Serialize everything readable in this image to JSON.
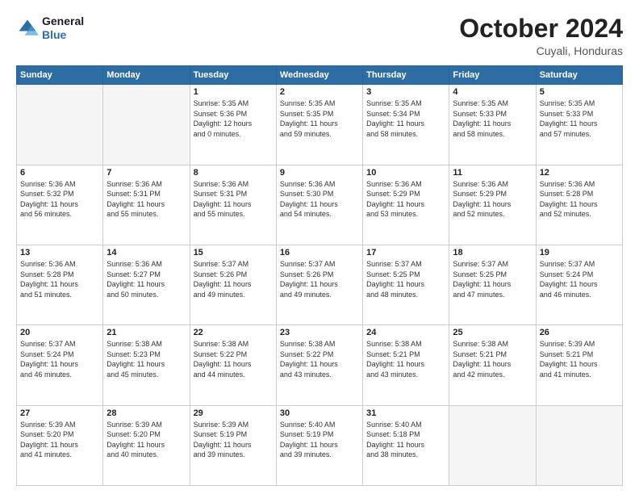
{
  "header": {
    "logo_line1": "General",
    "logo_line2": "Blue",
    "month": "October 2024",
    "location": "Cuyali, Honduras"
  },
  "weekdays": [
    "Sunday",
    "Monday",
    "Tuesday",
    "Wednesday",
    "Thursday",
    "Friday",
    "Saturday"
  ],
  "weeks": [
    [
      {
        "day": "",
        "empty": true
      },
      {
        "day": "",
        "empty": true
      },
      {
        "day": "1",
        "lines": [
          "Sunrise: 5:35 AM",
          "Sunset: 5:36 PM",
          "Daylight: 12 hours",
          "and 0 minutes."
        ]
      },
      {
        "day": "2",
        "lines": [
          "Sunrise: 5:35 AM",
          "Sunset: 5:35 PM",
          "Daylight: 11 hours",
          "and 59 minutes."
        ]
      },
      {
        "day": "3",
        "lines": [
          "Sunrise: 5:35 AM",
          "Sunset: 5:34 PM",
          "Daylight: 11 hours",
          "and 58 minutes."
        ]
      },
      {
        "day": "4",
        "lines": [
          "Sunrise: 5:35 AM",
          "Sunset: 5:33 PM",
          "Daylight: 11 hours",
          "and 58 minutes."
        ]
      },
      {
        "day": "5",
        "lines": [
          "Sunrise: 5:35 AM",
          "Sunset: 5:33 PM",
          "Daylight: 11 hours",
          "and 57 minutes."
        ]
      }
    ],
    [
      {
        "day": "6",
        "lines": [
          "Sunrise: 5:36 AM",
          "Sunset: 5:32 PM",
          "Daylight: 11 hours",
          "and 56 minutes."
        ]
      },
      {
        "day": "7",
        "lines": [
          "Sunrise: 5:36 AM",
          "Sunset: 5:31 PM",
          "Daylight: 11 hours",
          "and 55 minutes."
        ]
      },
      {
        "day": "8",
        "lines": [
          "Sunrise: 5:36 AM",
          "Sunset: 5:31 PM",
          "Daylight: 11 hours",
          "and 55 minutes."
        ]
      },
      {
        "day": "9",
        "lines": [
          "Sunrise: 5:36 AM",
          "Sunset: 5:30 PM",
          "Daylight: 11 hours",
          "and 54 minutes."
        ]
      },
      {
        "day": "10",
        "lines": [
          "Sunrise: 5:36 AM",
          "Sunset: 5:29 PM",
          "Daylight: 11 hours",
          "and 53 minutes."
        ]
      },
      {
        "day": "11",
        "lines": [
          "Sunrise: 5:36 AM",
          "Sunset: 5:29 PM",
          "Daylight: 11 hours",
          "and 52 minutes."
        ]
      },
      {
        "day": "12",
        "lines": [
          "Sunrise: 5:36 AM",
          "Sunset: 5:28 PM",
          "Daylight: 11 hours",
          "and 52 minutes."
        ]
      }
    ],
    [
      {
        "day": "13",
        "lines": [
          "Sunrise: 5:36 AM",
          "Sunset: 5:28 PM",
          "Daylight: 11 hours",
          "and 51 minutes."
        ]
      },
      {
        "day": "14",
        "lines": [
          "Sunrise: 5:36 AM",
          "Sunset: 5:27 PM",
          "Daylight: 11 hours",
          "and 50 minutes."
        ]
      },
      {
        "day": "15",
        "lines": [
          "Sunrise: 5:37 AM",
          "Sunset: 5:26 PM",
          "Daylight: 11 hours",
          "and 49 minutes."
        ]
      },
      {
        "day": "16",
        "lines": [
          "Sunrise: 5:37 AM",
          "Sunset: 5:26 PM",
          "Daylight: 11 hours",
          "and 49 minutes."
        ]
      },
      {
        "day": "17",
        "lines": [
          "Sunrise: 5:37 AM",
          "Sunset: 5:25 PM",
          "Daylight: 11 hours",
          "and 48 minutes."
        ]
      },
      {
        "day": "18",
        "lines": [
          "Sunrise: 5:37 AM",
          "Sunset: 5:25 PM",
          "Daylight: 11 hours",
          "and 47 minutes."
        ]
      },
      {
        "day": "19",
        "lines": [
          "Sunrise: 5:37 AM",
          "Sunset: 5:24 PM",
          "Daylight: 11 hours",
          "and 46 minutes."
        ]
      }
    ],
    [
      {
        "day": "20",
        "lines": [
          "Sunrise: 5:37 AM",
          "Sunset: 5:24 PM",
          "Daylight: 11 hours",
          "and 46 minutes."
        ]
      },
      {
        "day": "21",
        "lines": [
          "Sunrise: 5:38 AM",
          "Sunset: 5:23 PM",
          "Daylight: 11 hours",
          "and 45 minutes."
        ]
      },
      {
        "day": "22",
        "lines": [
          "Sunrise: 5:38 AM",
          "Sunset: 5:22 PM",
          "Daylight: 11 hours",
          "and 44 minutes."
        ]
      },
      {
        "day": "23",
        "lines": [
          "Sunrise: 5:38 AM",
          "Sunset: 5:22 PM",
          "Daylight: 11 hours",
          "and 43 minutes."
        ]
      },
      {
        "day": "24",
        "lines": [
          "Sunrise: 5:38 AM",
          "Sunset: 5:21 PM",
          "Daylight: 11 hours",
          "and 43 minutes."
        ]
      },
      {
        "day": "25",
        "lines": [
          "Sunrise: 5:38 AM",
          "Sunset: 5:21 PM",
          "Daylight: 11 hours",
          "and 42 minutes."
        ]
      },
      {
        "day": "26",
        "lines": [
          "Sunrise: 5:39 AM",
          "Sunset: 5:21 PM",
          "Daylight: 11 hours",
          "and 41 minutes."
        ]
      }
    ],
    [
      {
        "day": "27",
        "lines": [
          "Sunrise: 5:39 AM",
          "Sunset: 5:20 PM",
          "Daylight: 11 hours",
          "and 41 minutes."
        ]
      },
      {
        "day": "28",
        "lines": [
          "Sunrise: 5:39 AM",
          "Sunset: 5:20 PM",
          "Daylight: 11 hours",
          "and 40 minutes."
        ]
      },
      {
        "day": "29",
        "lines": [
          "Sunrise: 5:39 AM",
          "Sunset: 5:19 PM",
          "Daylight: 11 hours",
          "and 39 minutes."
        ]
      },
      {
        "day": "30",
        "lines": [
          "Sunrise: 5:40 AM",
          "Sunset: 5:19 PM",
          "Daylight: 11 hours",
          "and 39 minutes."
        ]
      },
      {
        "day": "31",
        "lines": [
          "Sunrise: 5:40 AM",
          "Sunset: 5:18 PM",
          "Daylight: 11 hours",
          "and 38 minutes."
        ]
      },
      {
        "day": "",
        "empty": true
      },
      {
        "day": "",
        "empty": true
      }
    ]
  ]
}
